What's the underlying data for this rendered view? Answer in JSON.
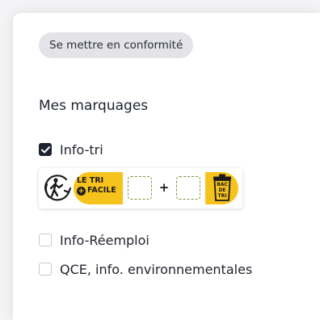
{
  "header": {
    "compliance_chip": "Se mettre en conformité"
  },
  "marquages": {
    "title": "Mes marquages",
    "options": [
      {
        "label": "Info-tri",
        "checked": true
      },
      {
        "label": "Info-Réemploi",
        "checked": false
      },
      {
        "label": "QCE, info. environnementales",
        "checked": false
      }
    ],
    "info_tri_logo": {
      "line1": "LE TRI",
      "line2_badge": "+",
      "line2": "FACILE",
      "plus": "+",
      "bin_text": [
        "BAC",
        "DE",
        "TRI"
      ],
      "colors": {
        "band": "#f6c31c",
        "ink": "#1a1a1a",
        "slot_border": "#7a9a4a"
      }
    }
  }
}
